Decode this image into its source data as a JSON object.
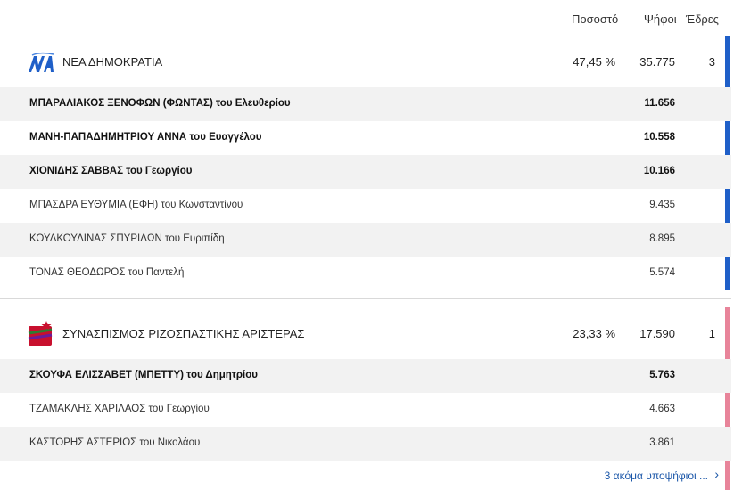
{
  "header": {
    "percent": "Ποσοστό",
    "votes": "Ψήφοι",
    "seats": "Έδρες"
  },
  "parties": [
    {
      "name": "ΝΕΑ ΔΗΜΟΚΡΑΤΙΑ",
      "percent": "47,45 %",
      "votes": "35.775",
      "seats": "3",
      "color": "#1f5fc8",
      "candidates": [
        {
          "name": "ΜΠΑΡΑΛΙΑΚΟΣ ΞΕΝΟΦΩΝ (ΦΩΝΤΑΣ) του Ελευθερίου",
          "votes": "11.656"
        },
        {
          "name": "ΜΑΝΗ-ΠΑΠΑΔΗΜΗΤΡΙΟΥ ΑΝΝΑ του Ευαγγέλου",
          "votes": "10.558"
        },
        {
          "name": "ΧΙΟΝΙΔΗΣ ΣΑΒΒΑΣ του Γεωργίου",
          "votes": "10.166"
        },
        {
          "name": "ΜΠΑΣΔΡΑ ΕΥΘΥΜΙΑ (ΕΦΗ) του Κωνσταντίνου",
          "votes": "9.435"
        },
        {
          "name": "ΚΟΥΛΚΟΥΔΙΝΑΣ ΣΠΥΡΙΔΩΝ του Ευριπίδη",
          "votes": "8.895"
        },
        {
          "name": "ΤΟΝΑΣ ΘΕΟΔΩΡΟΣ του Παντελή",
          "votes": "5.574"
        }
      ]
    },
    {
      "name": "ΣΥΝΑΣΠΙΣΜΟΣ ΡΙΖΟΣΠΑΣΤΙΚΗΣ ΑΡΙΣΤΕΡΑΣ",
      "percent": "23,33 %",
      "votes": "17.590",
      "seats": "1",
      "color": "#e8849a",
      "candidates": [
        {
          "name": "ΣΚΟΥΦΑ ΕΛΙΣΣΑΒΕΤ (ΜΠΕΤΤΥ) του Δημητρίου",
          "votes": "5.763"
        },
        {
          "name": "ΤΖΑΜΑΚΛΗΣ ΧΑΡΙΛΑΟΣ του Γεωργίου",
          "votes": "4.663"
        },
        {
          "name": "ΚΑΣΤΟΡΗΣ ΑΣΤΕΡΙΟΣ του Νικολάου",
          "votes": "3.861"
        }
      ]
    }
  ],
  "more_link": "3 ακόμα υποψήφιοι ...",
  "icons": {
    "nd_logo": "nd-logo-icon",
    "syriza_logo": "syriza-logo-icon",
    "more": "chevron-right-icon"
  }
}
